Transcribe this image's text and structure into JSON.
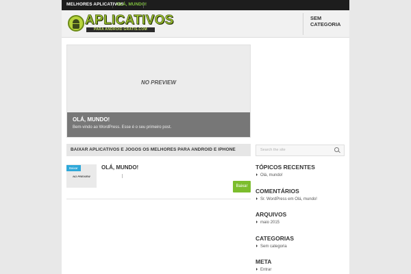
{
  "topbar": {
    "item1": "MELHORES APLICATIVOS",
    "item2": "OLÁ, MUNDO!"
  },
  "header": {
    "logo_word": "APLICATIVOS",
    "logo_sub": "PARA ANDROID GRATIS.COM",
    "menu_item": "SEM CATEGORIA"
  },
  "featured": {
    "no_preview": "NO PREVIEW",
    "title": "OLÁ, MUNDO!",
    "excerpt": "Bem-vindo ao WordPress. Esse é o seu primeiro post."
  },
  "section": {
    "title": "BAIXAR APLICATIVOS E JOGOS OS MELHORES PARA ANDROID E IPHONE"
  },
  "post": {
    "badge": "Baixar",
    "no_preview": "NO PREVIEW",
    "title": "OLÁ, MUNDO!",
    "button": "Baixar"
  },
  "sidebar": {
    "search_placeholder": "Search the site",
    "widgets": [
      {
        "title": "TÓPICOS RECENTES",
        "items": [
          "Olá, mundo!"
        ]
      },
      {
        "title": "COMENTÁRIOS",
        "items": [
          "Sr. WordPress em Olá, mundo!"
        ]
      },
      {
        "title": "ARQUIVOS",
        "items": [
          "maio 2015"
        ]
      },
      {
        "title": "CATEGORIAS",
        "items": [
          "Sem categoria"
        ]
      },
      {
        "title": "META",
        "items": [
          "Entrar"
        ]
      }
    ]
  },
  "colors": {
    "accent_green": "#7cbd2d",
    "badge_blue": "#2fa8d9",
    "topbar_bg": "#1d1d1d"
  }
}
